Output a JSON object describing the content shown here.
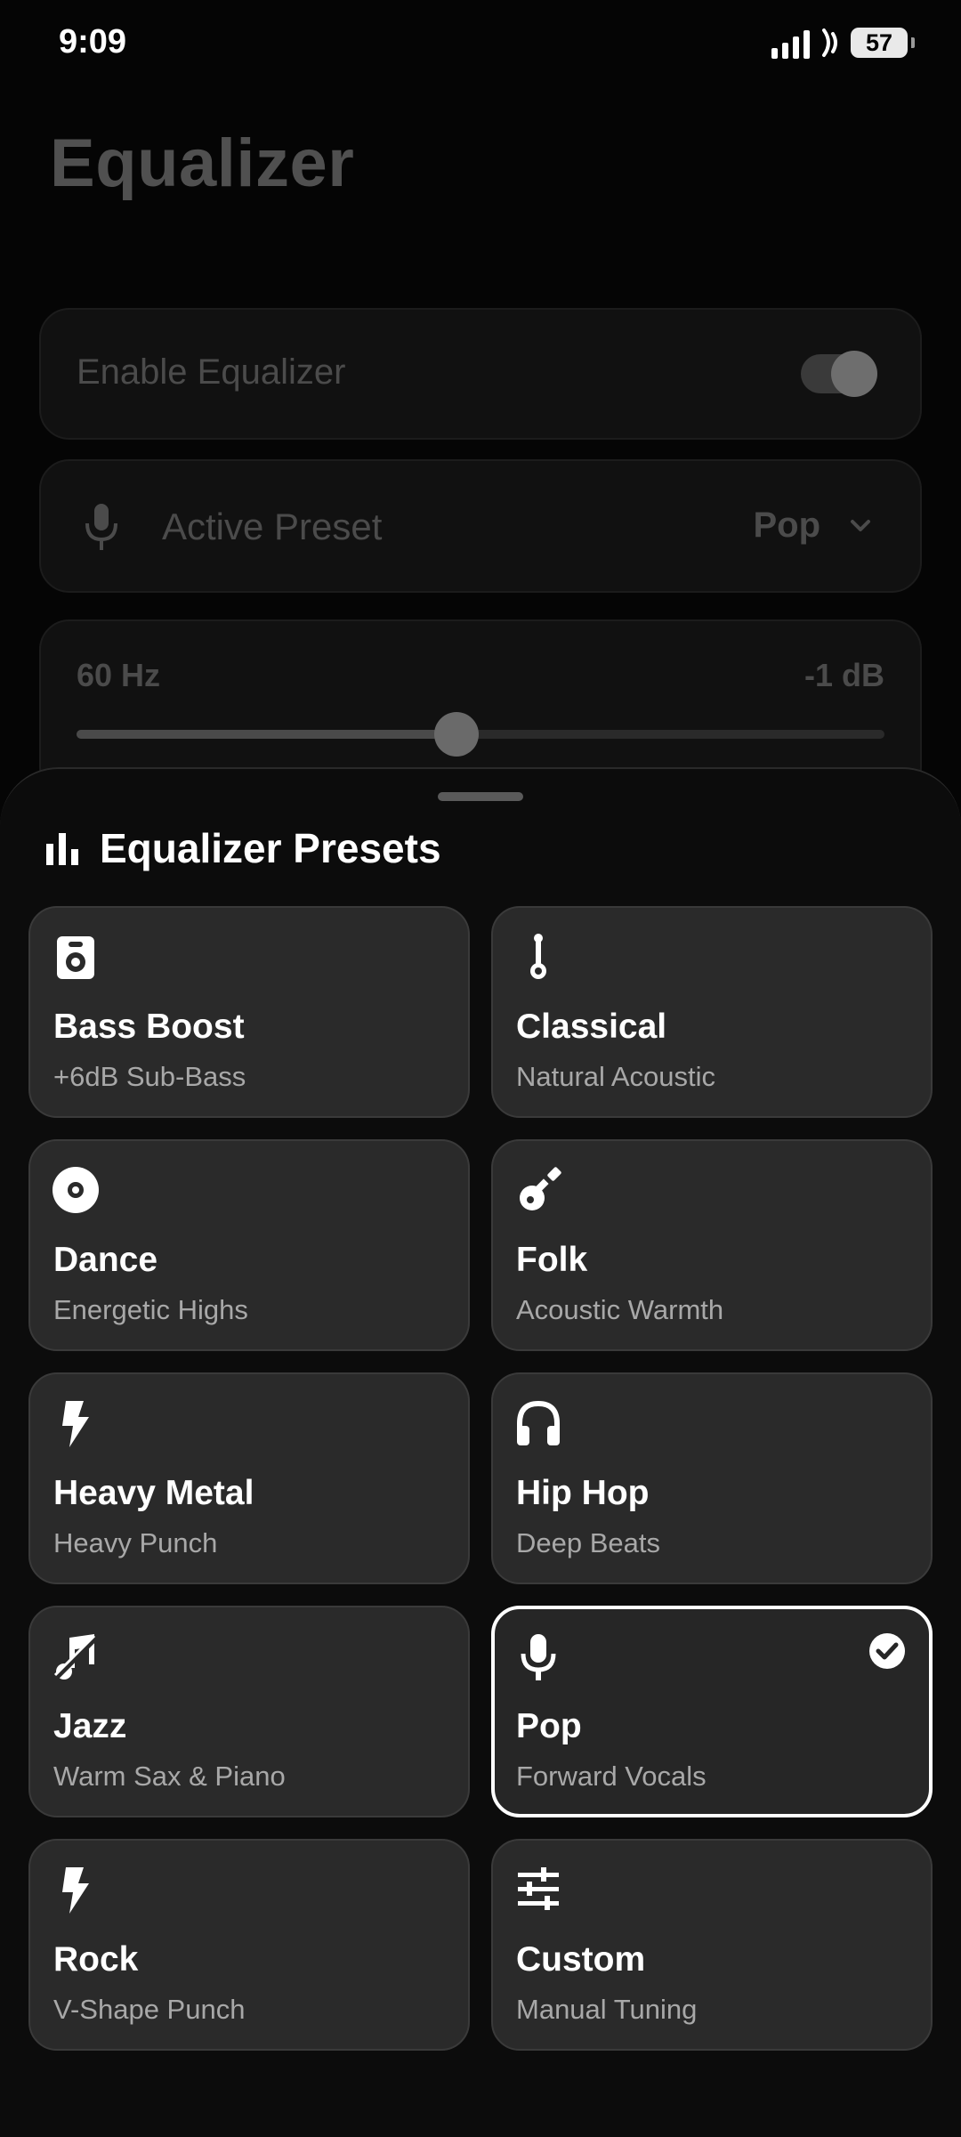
{
  "status": {
    "time": "9:09",
    "battery": "57"
  },
  "page": {
    "title": "Equalizer",
    "enable_label": "Enable Equalizer",
    "enable_on": true,
    "active_preset_label": "Active Preset",
    "active_preset_value": "Pop",
    "band": {
      "label": "60 Hz",
      "value": "-1 dB",
      "slider_fraction": 0.47
    }
  },
  "sheet": {
    "title": "Equalizer Presets",
    "presets": [
      {
        "name": "Bass Boost",
        "subtitle": "+6dB Sub-Bass",
        "icon": "speaker-icon",
        "selected": false
      },
      {
        "name": "Classical",
        "subtitle": "Natural Acoustic",
        "icon": "piano-key-icon",
        "selected": false
      },
      {
        "name": "Dance",
        "subtitle": "Energetic Highs",
        "icon": "disc-icon",
        "selected": false
      },
      {
        "name": "Folk",
        "subtitle": "Acoustic Warmth",
        "icon": "guitar-icon",
        "selected": false
      },
      {
        "name": "Heavy Metal",
        "subtitle": "Heavy Punch",
        "icon": "bolt-icon",
        "selected": false
      },
      {
        "name": "Hip Hop",
        "subtitle": "Deep Beats",
        "icon": "headphones-icon",
        "selected": false
      },
      {
        "name": "Jazz",
        "subtitle": "Warm Sax & Piano",
        "icon": "music-off-icon",
        "selected": false
      },
      {
        "name": "Pop",
        "subtitle": "Forward Vocals",
        "icon": "mic-icon",
        "selected": true
      },
      {
        "name": "Rock",
        "subtitle": "V-Shape Punch",
        "icon": "bolt-icon",
        "selected": false
      },
      {
        "name": "Custom",
        "subtitle": "Manual Tuning",
        "icon": "tune-icon",
        "selected": false
      }
    ]
  }
}
